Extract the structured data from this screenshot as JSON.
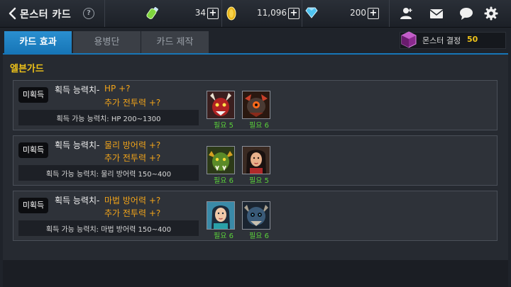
{
  "header": {
    "title": "몬스터 카드",
    "help_label": "?",
    "resources": [
      {
        "icon": "energy-potion-icon",
        "value": "34"
      },
      {
        "icon": "gold-coin-icon",
        "value": "11,096"
      },
      {
        "icon": "diamond-icon",
        "value": "200"
      }
    ],
    "plus_label": "+",
    "menu_icons": [
      "add-friend-icon",
      "mail-icon",
      "chat-icon",
      "settings-gear-icon"
    ]
  },
  "tabs": [
    {
      "label": "카드 효과",
      "active": true
    },
    {
      "label": "용병단",
      "active": false
    },
    {
      "label": "카드 제작",
      "active": false
    }
  ],
  "crystal": {
    "label": "몬스터 결정",
    "value": "50",
    "icon": "monster-crystal-icon"
  },
  "section": {
    "title": "엘븐가드"
  },
  "cards": [
    {
      "status": "미획득",
      "stat_label": "획득 능력치-",
      "stat_main": "HP +?",
      "stat_sub": "추가 전투력 +?",
      "range": "획득 가능 능력치: HP 200~1300",
      "monsters": [
        {
          "portrait": "red-demon-portrait",
          "req": "필요 5"
        },
        {
          "portrait": "dark-beast-portrait",
          "req": "필요 6"
        }
      ]
    },
    {
      "status": "미획득",
      "stat_label": "획득 능력치-",
      "stat_main": "물리 방어력 +?",
      "stat_sub": "추가 전투력 +?",
      "range": "획득 가능 능력치: 물리 방어력 150~400",
      "monsters": [
        {
          "portrait": "green-orc-portrait",
          "req": "필요 6"
        },
        {
          "portrait": "dark-haired-woman-portrait",
          "req": "필요 5"
        }
      ]
    },
    {
      "status": "미획득",
      "stat_label": "획득 능력치-",
      "stat_main": "마법 방어력 +?",
      "stat_sub": "추가 전투력 +?",
      "range": "획득 가능 능력치: 마법 방어력 150~400",
      "monsters": [
        {
          "portrait": "teal-sorceress-portrait",
          "req": "필요 6"
        },
        {
          "portrait": "blue-skull-beast-portrait",
          "req": "필요 6"
        }
      ]
    }
  ],
  "colors": {
    "accent_blue": "#1776b7",
    "gold_text": "#f0c419",
    "orange_text": "#f0a31a",
    "green_req": "#5ad13a"
  }
}
